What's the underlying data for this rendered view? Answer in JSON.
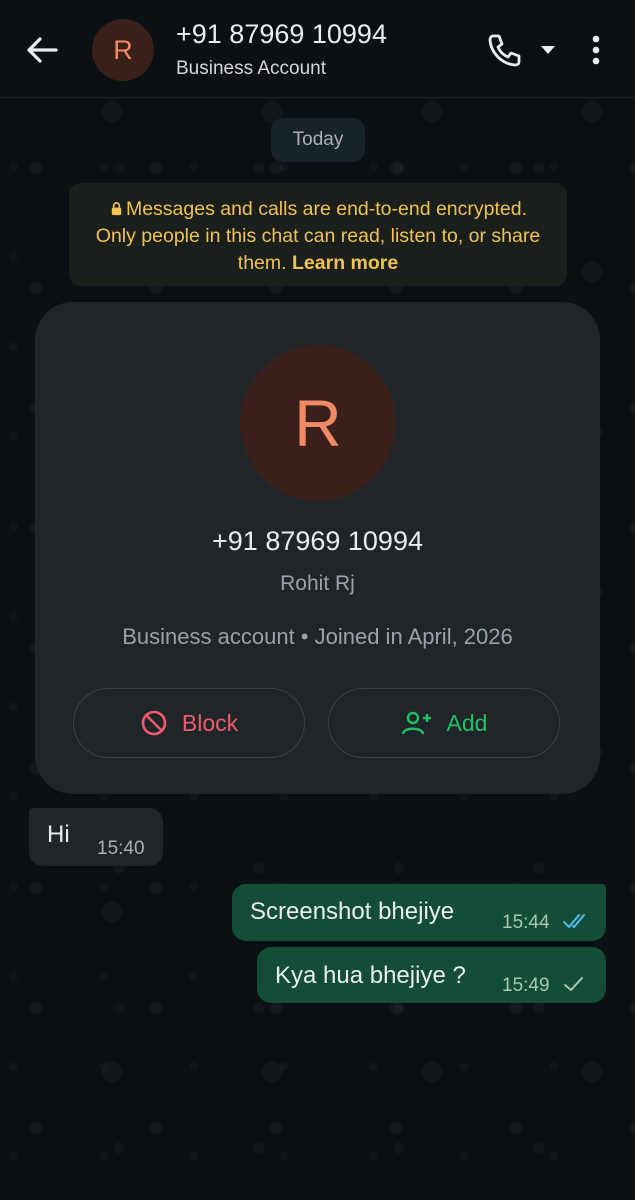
{
  "header": {
    "back_icon": "arrow-left-icon",
    "avatar_letter": "R",
    "title": "+91 87969 10994",
    "subtitle": "Business Account",
    "call_icon": "phone-icon",
    "dropdown_icon": "caret-down-icon",
    "menu_icon": "more-vertical-icon"
  },
  "chat": {
    "date_chip": "Today",
    "encryption": {
      "text": "Messages and calls are end-to-end encrypted. Only people in this chat can read, listen to, or share them.",
      "learn_more": "Learn more",
      "icon": "lock-icon"
    },
    "profile_card": {
      "avatar_letter": "R",
      "phone": "+91 87969 10994",
      "name": "Rohit Rj",
      "info": "Business account • Joined in April, 2026",
      "block_label": "Block",
      "block_icon": "block-icon",
      "add_label": "Add",
      "add_icon": "add-contact-icon"
    },
    "messages": [
      {
        "direction": "incoming",
        "text": "Hi",
        "time": "15:40"
      },
      {
        "direction": "outgoing",
        "text": "Screenshot bhejiye",
        "time": "15:44",
        "status": "read"
      },
      {
        "direction": "outgoing",
        "text": "Kya hua bhejiye ?",
        "time": "15:49",
        "status": "sent"
      }
    ]
  },
  "colors": {
    "background": "#0b1014",
    "outgoing_bubble": "#134d37",
    "incoming_bubble": "#1f2528",
    "encryption_text": "#f0c254",
    "block_red": "#f15c6d",
    "add_green": "#21c063",
    "read_tick_blue": "#53bdeb",
    "avatar_bg": "#3a201b",
    "avatar_fg": "#f08a66"
  }
}
